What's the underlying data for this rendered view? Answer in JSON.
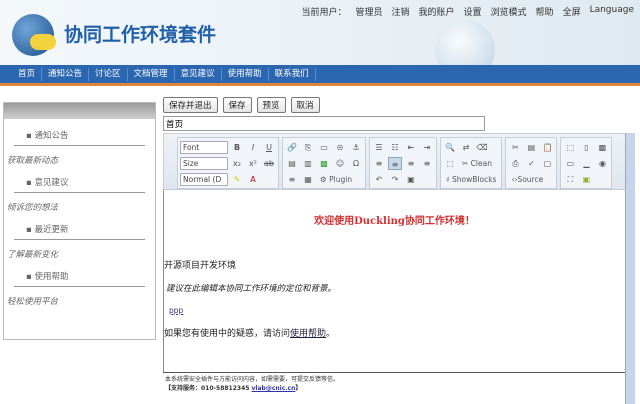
{
  "header": {
    "title": "协同工作环境套件",
    "links": [
      "当前用户：",
      "管理员",
      "注销",
      "我的账户",
      "设置",
      "浏览模式",
      "帮助",
      "全屏",
      "Language"
    ]
  },
  "nav": [
    "首页",
    "通知公告",
    "讨论区",
    "文档管理",
    "意见建议",
    "使用帮助",
    "联系我们"
  ],
  "sidebar": [
    {
      "item": "通知公告",
      "tag": "获取最新动态"
    },
    {
      "item": "意见建议",
      "tag": "倾诉您的想法"
    },
    {
      "item": "最近更新",
      "tag": "了解最新变化"
    },
    {
      "item": "使用帮助",
      "tag": "轻松使用平台"
    }
  ],
  "buttons": {
    "save_exit": "保存并退出",
    "save": "保存",
    "preview": "预览",
    "cancel": "取消"
  },
  "title_value": "首页",
  "toolbar": {
    "font": "Font",
    "size": "Size",
    "format": "Normal (D",
    "plugin": "Plugin",
    "clean": "Clean",
    "showblocks": "ShowBlocks",
    "source": "Source"
  },
  "content": {
    "welcome": "欢迎使用Duckling协同工作环境！",
    "p1": "开源项目开发环境",
    "p2": "建议在此编辑本协同工作环境的定位和背景。",
    "p3": "ppp",
    "p4_pre": "如果您有使用中的疑惑，请访问",
    "p4_link": "使用帮助",
    "p4_post": "。"
  },
  "footer": {
    "line1": "本系统需安全插件与方能访问内容，如需需要，可提交反馈等信。",
    "line2_pre": "【支持服务：010-58812345 ",
    "email": "vlab@cnic.cn",
    "line2_post": "】"
  }
}
